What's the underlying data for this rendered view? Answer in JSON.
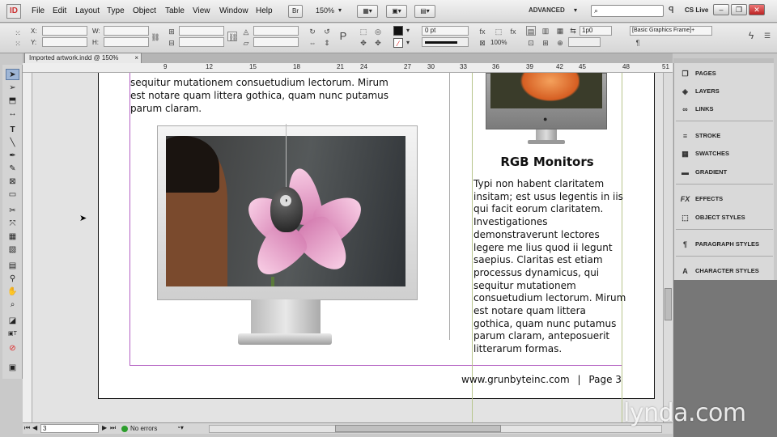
{
  "app": {
    "logo": "ID"
  },
  "menu": [
    "File",
    "Edit",
    "Layout",
    "Type",
    "Object",
    "Table",
    "View",
    "Window",
    "Help"
  ],
  "toolbar": {
    "zoom": "150%",
    "workspace": "ADVANCED",
    "cs_live": "CS Live"
  },
  "control": {
    "x_label": "X:",
    "y_label": "Y:",
    "w_label": "W:",
    "h_label": "H:",
    "stroke_weight": "0 pt",
    "opacity": "100%",
    "spacing": "1p0",
    "object_style": "[Basic Graphics Frame]+"
  },
  "document": {
    "tab_title": "Imported artwork.indd @ 150%",
    "close": "×"
  },
  "ruler": {
    "marks": [
      "9",
      "12",
      "15",
      "18",
      "21",
      "24",
      "27",
      "30",
      "33",
      "36",
      "39",
      "42",
      "45",
      "48",
      "51"
    ]
  },
  "page": {
    "body_text": "sequitur mutationem consuetudium lectorum. Mirum est notare quam littera gothica, quam nunc putamus parum claram.",
    "sidebar_heading": "RGB Monitors",
    "sidebar_text": "Typi non habent claritatem insitam; est usus legentis in iis qui facit eorum claritatem. Investigationes demonstraverunt lectores legere me lius quod ii legunt saepius. Claritas est etiam processus dynamicus, qui sequitur mutationem consuetudium lectorum. Mirum est notare quam littera gothica, quam nunc putamus parum claram, anteposuerit litterarum formas.",
    "footer_url": "www.grunbyteinc.com",
    "footer_sep": "|",
    "footer_page": "Page 3"
  },
  "status": {
    "page_number": "3",
    "preflight": "No errors"
  },
  "panels": [
    {
      "label": "PAGES",
      "icon": "pages-icon"
    },
    {
      "label": "LAYERS",
      "icon": "layers-icon"
    },
    {
      "label": "LINKS",
      "icon": "links-icon"
    },
    {
      "label": "STROKE",
      "icon": "stroke-icon"
    },
    {
      "label": "SWATCHES",
      "icon": "swatches-icon"
    },
    {
      "label": "GRADIENT",
      "icon": "gradient-icon"
    },
    {
      "label": "EFFECTS",
      "icon": "effects-icon"
    },
    {
      "label": "OBJECT STYLES",
      "icon": "object-styles-icon"
    },
    {
      "label": "PARAGRAPH STYLES",
      "icon": "paragraph-styles-icon"
    },
    {
      "label": "CHARACTER STYLES",
      "icon": "character-styles-icon"
    }
  ],
  "watermark": "lynda.com",
  "colors": {
    "margin_guide": "#b35fc2",
    "column_guide": "#b6c58b",
    "preflight_ok": "#2c9e2c"
  }
}
